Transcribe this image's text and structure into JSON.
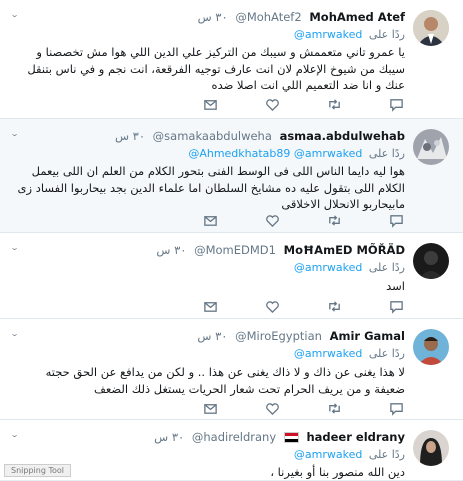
{
  "chevron": "⌄",
  "tweets": [
    {
      "name": "MohAmed Atef",
      "handle": "@MohAtef2",
      "time": "٣٠ س",
      "reply_prefix": "ردًا على",
      "reply_to": "@amrwaked",
      "body": "يا عمرو تاني متعممش و سيبك من التركيز علي الدين اللي هوا مش تخصصنا و سيبك من شيوخ الإعلام لان انت عارف توجيه الفرقعة، انت نجم و في ناس بتنقل عنك و انا ضد التعميم اللي انت اصلا ضده"
    },
    {
      "name": "asmaa.abdulwehab",
      "handle": "@samakaabdulweha",
      "time": "٣٠ س",
      "reply_prefix": "ردًا على",
      "reply_to": "@Ahmedkhatab89 @amrwaked",
      "body": "هوا ليه دايما الناس اللى فى الوسط الفنى بتحور الكلام من العلم ان اللى بيعمل الكلام اللى بتقول عليه ده مشايخ السلطان اما علماء الدين بجد بيحاربوا الفساد زى مابيحاربو الانحلال الاخلاقى"
    },
    {
      "name": "MoĦAmED MÕŘÄD",
      "handle": "@MomEDMD1",
      "time": "٣٠ س",
      "reply_prefix": "ردًا على",
      "reply_to": "@amrwaked",
      "body": "اسد"
    },
    {
      "name": "Amir Gamal",
      "handle": "@MiroEgyptian",
      "time": "٣٠ س",
      "reply_prefix": "ردًا على",
      "reply_to": "@amrwaked",
      "body": "لا هذا يغنى عن ذاك و لا ذاك يغنى عن هذا .. و لكن من يدافع عن الحق حجته ضعيفة و من يريف الحرام تحت شعار الحريات يستغل ذلك الضعف"
    },
    {
      "name": "hadeer eldrany",
      "handle": "@hadireldrany",
      "time": "٣٠ س",
      "reply_prefix": "ردًا على",
      "reply_to": "@amrwaked",
      "body": "دين الله منصور بنا أو بغيرنا ،"
    }
  ],
  "snipping_tool": "Snipping Tool"
}
